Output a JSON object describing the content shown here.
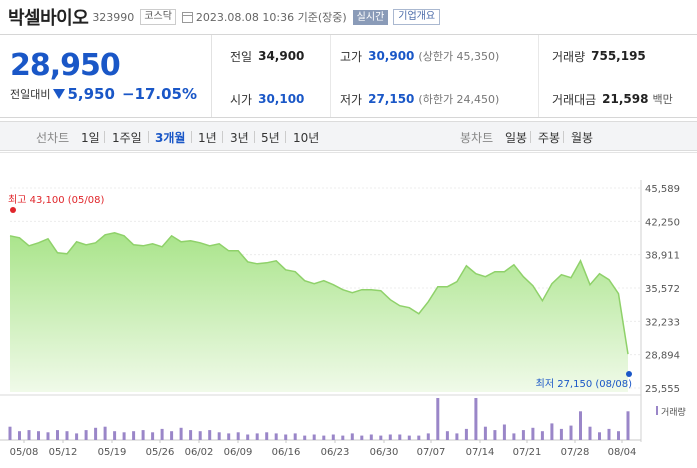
{
  "header": {
    "name": "박셀바이오",
    "code": "323990",
    "market_tag": "코스닥",
    "datetime": "2023.08.08 10:36 기준(장중)",
    "realtime_label": "실시간",
    "company_label": "기업개요"
  },
  "price": {
    "current": "28,950",
    "change_label": "전일대비",
    "change_value": "5,950",
    "change_rate": "−17.05%"
  },
  "stats": {
    "prev_label": "전일",
    "prev_value": "34,900",
    "high_label": "고가",
    "high_value": "30,900",
    "high_sub": "(상한가 45,350)",
    "volume_label": "거래량",
    "volume_value": "755,195",
    "open_label": "시가",
    "open_value": "30,100",
    "low_label": "저가",
    "low_value": "27,150",
    "low_sub": "(하한가 24,450)",
    "amount_label": "거래대금",
    "amount_value": "21,598",
    "amount_unit": "백만"
  },
  "period_bar": {
    "line_label": "선차트",
    "periods": [
      "1일",
      "1주일",
      "3개월",
      "1년",
      "3년",
      "5년",
      "10년"
    ],
    "active_period": "3개월",
    "candle_label": "봉차트",
    "candles": [
      "일봉",
      "주봉",
      "월봉"
    ]
  },
  "colors": {
    "line": "#8fd16a",
    "fill_top": "#a9e48a",
    "fill_bottom": "#f0fae9",
    "volume": "#9a86c8",
    "high_dot": "#e0262b",
    "low_dot": "#1a57c7",
    "price_down": "#1a57c7"
  },
  "chart_data": {
    "type": "area",
    "y_ticks": [
      "45,589",
      "42,250",
      "38,911",
      "35,572",
      "32,233",
      "28,894",
      "25,555"
    ],
    "ylim": [
      25555,
      45589
    ],
    "x_ticks": [
      "05/08",
      "05/12",
      "05/19",
      "05/26",
      "06/02",
      "06/09",
      "06/16",
      "06/23",
      "06/30",
      "07/07",
      "07/14",
      "07/21",
      "07/28",
      "08/04"
    ],
    "high_label": "최고 43,100 (05/08)",
    "low_label": "최저 27,150 (08/08)",
    "volume_label": "거래량",
    "price": [
      40800,
      40600,
      39800,
      40100,
      40500,
      39100,
      39000,
      40200,
      39900,
      40100,
      40900,
      41100,
      40800,
      39900,
      39800,
      40000,
      39700,
      40800,
      40200,
      40300,
      40100,
      39800,
      40000,
      39300,
      39300,
      38200,
      38000,
      38100,
      38300,
      37400,
      37200,
      36300,
      36000,
      36300,
      35900,
      35400,
      35100,
      35400,
      35400,
      35300,
      34400,
      33800,
      33600,
      33000,
      34200,
      35700,
      35700,
      36200,
      37800,
      37000,
      36700,
      37200,
      37200,
      37900,
      36700,
      35800,
      34300,
      36000,
      36900,
      36600,
      38300,
      35900,
      37000,
      36400,
      35000,
      28950
    ],
    "volume": [
      12,
      8,
      9,
      8,
      7,
      9,
      8,
      6,
      9,
      11,
      12,
      8,
      7,
      8,
      9,
      7,
      10,
      8,
      11,
      9,
      8,
      9,
      7,
      6,
      7,
      5,
      6,
      7,
      6,
      5,
      6,
      4,
      5,
      4,
      5,
      4,
      6,
      4,
      5,
      4,
      5,
      5,
      4,
      4,
      6,
      38,
      8,
      6,
      10,
      38,
      12,
      9,
      14,
      6,
      9,
      11,
      8,
      15,
      10,
      13,
      26,
      12,
      7,
      10,
      8,
      26
    ]
  }
}
